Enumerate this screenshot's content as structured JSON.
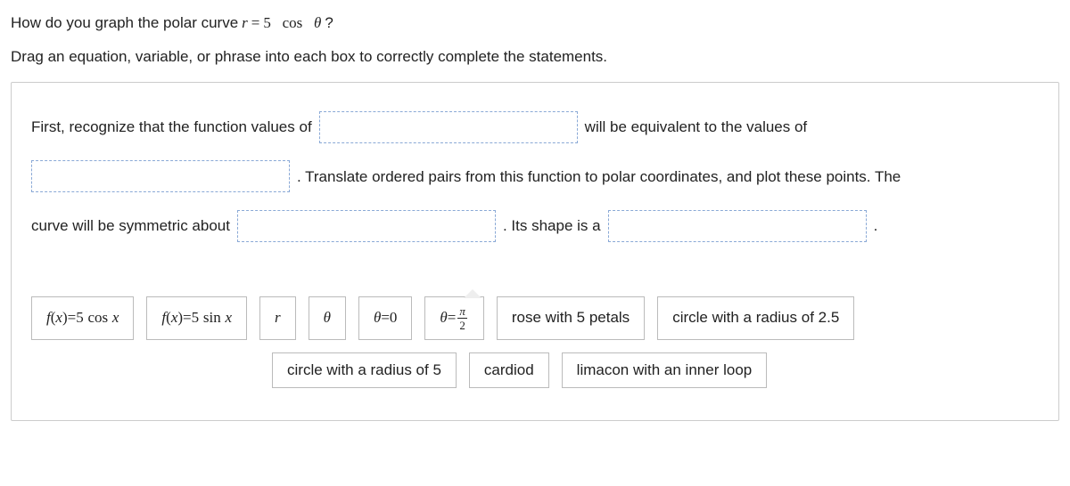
{
  "question": {
    "prefix": "How do you graph the polar curve ",
    "equation_lhs": "r",
    "equals": " = ",
    "equation_rhs_num": "5",
    "equation_rhs_fn": "cos",
    "equation_rhs_var": "θ",
    "suffix": "?"
  },
  "instructions": "Drag an equation, variable, or phrase into each box to correctly complete the statements.",
  "statement": {
    "s1": "First, recognize that the function values of",
    "s2": "will be equivalent to the values of",
    "s3": ". Translate ordered pairs from this function to polar coordinates, and plot these points. The",
    "s4": "curve will be symmetric about",
    "s5": ". Its shape is a",
    "s6": "."
  },
  "choices": {
    "c1_f": "f",
    "c1_paren_open": "(",
    "c1_x": "x",
    "c1_paren_close": ")",
    "c1_eq": " = ",
    "c1_num": "5",
    "c1_fn": "cos",
    "c1_var": "x",
    "c2_f": "f",
    "c2_paren_open": "(",
    "c2_x": "x",
    "c2_paren_close": ")",
    "c2_eq": " = ",
    "c2_num": "5",
    "c2_fn": "sin",
    "c2_var": "x",
    "c3": "r",
    "c4": "θ",
    "c5_lhs": "θ",
    "c5_eq": " = ",
    "c5_rhs": "0",
    "c6_lhs": "θ",
    "c6_eq": " = ",
    "c6_num": "π",
    "c6_den": "2",
    "c7": "rose with 5 petals",
    "c8": "circle with a radius of 2.5",
    "c9": "circle with a radius of 5",
    "c10": "cardiod",
    "c11": "limacon with an inner loop"
  }
}
